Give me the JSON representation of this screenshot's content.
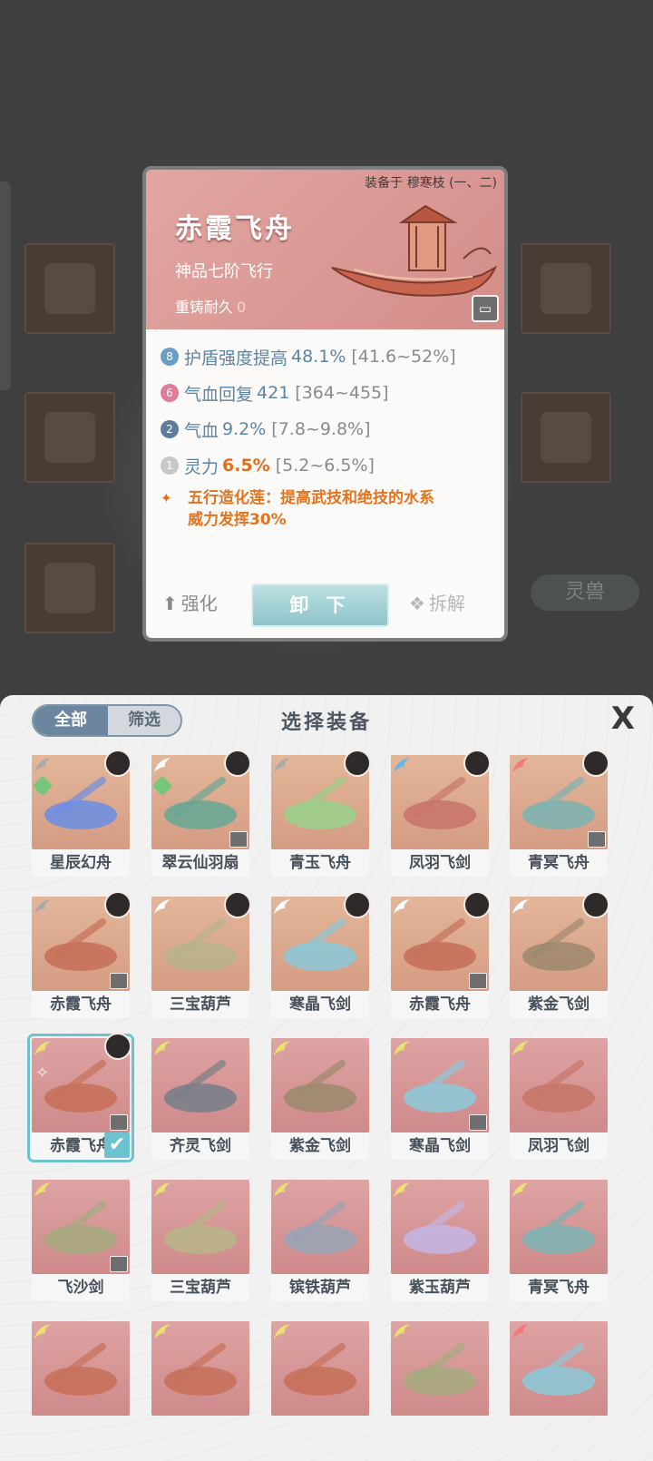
{
  "background": {
    "side_tab_label": "灵兽"
  },
  "popup": {
    "equipped_on": "装备于 穆寒枝 (一、二)",
    "title": "赤霞飞舟",
    "grade": "神品七阶飞行",
    "durability_label": "重铸耐久",
    "durability_value": "0",
    "stats": [
      {
        "badge": "8",
        "badge_color": "#6a9ec7",
        "label": "护盾强度提高",
        "value": "48.1%",
        "range": "[41.6~52%]",
        "highlight": false
      },
      {
        "badge": "6",
        "badge_color": "#e07b9a",
        "label": "气血回复",
        "value": "421",
        "range": "[364~455]",
        "highlight": false
      },
      {
        "badge": "2",
        "badge_color": "#5d7d9c",
        "label": "气血",
        "value": "9.2%",
        "range": "[7.8~9.8%]",
        "highlight": false
      },
      {
        "badge": "1",
        "badge_color": "#c8c8c8",
        "label": "灵力",
        "value": "6.5%",
        "range": "[5.2~6.5%]",
        "highlight": true
      }
    ],
    "effect_line1": "五行造化莲：提高武技和绝技的水系",
    "effect_line2": "威力发挥30%",
    "buttons": {
      "strengthen": "强化",
      "unequip": "卸 下",
      "dismantle": "拆解"
    }
  },
  "panel": {
    "title": "选择装备",
    "seg_all": "全部",
    "seg_filter": "筛选",
    "close": "X",
    "items": [
      {
        "name": "星辰幻舟",
        "bg": "orange",
        "wing": "#aaaaaa",
        "avatar": true,
        "tag": false,
        "art": "#6f8fe0",
        "gem": true
      },
      {
        "name": "翠云仙羽扇",
        "bg": "orange",
        "wing": "#ffffff",
        "avatar": true,
        "tag": true,
        "art": "#6aa793",
        "gem": true
      },
      {
        "name": "青玉飞舟",
        "bg": "orange",
        "wing": "#aaaaaa",
        "avatar": true,
        "tag": false,
        "art": "#9ccf8c",
        "gem": false
      },
      {
        "name": "凤羽飞剑",
        "bg": "orange",
        "wing": "#6ab6e6",
        "avatar": true,
        "tag": false,
        "art": "#c8776a",
        "gem": false
      },
      {
        "name": "青冥飞舟",
        "bg": "orange",
        "wing": "#f07a7a",
        "avatar": true,
        "tag": true,
        "art": "#7fb3b0",
        "gem": false
      },
      {
        "name": "赤霞飞舟",
        "bg": "orange",
        "wing": "#aaaaaa",
        "avatar": true,
        "tag": true,
        "art": "#c7715b",
        "gem": false
      },
      {
        "name": "三宝葫芦",
        "bg": "orange",
        "wing": "#ffffff",
        "avatar": true,
        "tag": false,
        "art": "#b9b48a",
        "gem": false
      },
      {
        "name": "寒晶飞剑",
        "bg": "orange",
        "wing": "#ffffff",
        "avatar": true,
        "tag": false,
        "art": "#8fc7d6",
        "gem": false
      },
      {
        "name": "赤霞飞舟",
        "bg": "orange",
        "wing": "#ffffff",
        "avatar": true,
        "tag": true,
        "art": "#c7715b",
        "gem": false
      },
      {
        "name": "紫金飞剑",
        "bg": "orange",
        "wing": "#ffffff",
        "avatar": true,
        "tag": false,
        "art": "#9f8a6f",
        "gem": false
      },
      {
        "name": "赤霞飞舟",
        "bg": "red",
        "wing": "#e8e070",
        "avatar": true,
        "tag": true,
        "art": "#c7715b",
        "gem": false,
        "selected": true
      },
      {
        "name": "齐灵飞剑",
        "bg": "red",
        "wing": "#e8e070",
        "avatar": false,
        "tag": false,
        "art": "#7a7f88",
        "gem": false
      },
      {
        "name": "紫金飞剑",
        "bg": "red",
        "wing": "#e8e070",
        "avatar": false,
        "tag": false,
        "art": "#9f8a6f",
        "gem": false
      },
      {
        "name": "寒晶飞剑",
        "bg": "red",
        "wing": "#e8e070",
        "avatar": false,
        "tag": true,
        "art": "#8fc7d6",
        "gem": false
      },
      {
        "name": "凤羽飞剑",
        "bg": "red",
        "wing": "#e8e070",
        "avatar": false,
        "tag": false,
        "art": "#c8776a",
        "gem": false
      },
      {
        "name": "飞沙剑",
        "bg": "red",
        "wing": "#e8e070",
        "avatar": false,
        "tag": true,
        "art": "#a7aa80",
        "gem": false
      },
      {
        "name": "三宝葫芦",
        "bg": "red",
        "wing": "#e8e070",
        "avatar": false,
        "tag": false,
        "art": "#b9b48a",
        "gem": false
      },
      {
        "name": "镔铁葫芦",
        "bg": "red",
        "wing": "#e8e070",
        "avatar": false,
        "tag": false,
        "art": "#9aa3b5",
        "gem": false
      },
      {
        "name": "紫玉葫芦",
        "bg": "red",
        "wing": "#e8e070",
        "avatar": false,
        "tag": false,
        "art": "#c5b4e0",
        "gem": false
      },
      {
        "name": "青冥飞舟",
        "bg": "red",
        "wing": "#e8e070",
        "avatar": false,
        "tag": false,
        "art": "#7fb3b0",
        "gem": false
      },
      {
        "name": "",
        "bg": "red",
        "wing": "#e8e070",
        "avatar": false,
        "tag": false,
        "art": "#c7715b",
        "gem": false
      },
      {
        "name": "",
        "bg": "red",
        "wing": "#e8e070",
        "avatar": false,
        "tag": false,
        "art": "#c7715b",
        "gem": false
      },
      {
        "name": "",
        "bg": "red",
        "wing": "#e8e070",
        "avatar": false,
        "tag": false,
        "art": "#c7715b",
        "gem": false
      },
      {
        "name": "",
        "bg": "red",
        "wing": "#e8e070",
        "avatar": false,
        "tag": false,
        "art": "#a7aa80",
        "gem": false
      },
      {
        "name": "",
        "bg": "red",
        "wing": "#f07a7a",
        "avatar": false,
        "tag": false,
        "art": "#8fc7d6",
        "gem": false
      }
    ]
  }
}
